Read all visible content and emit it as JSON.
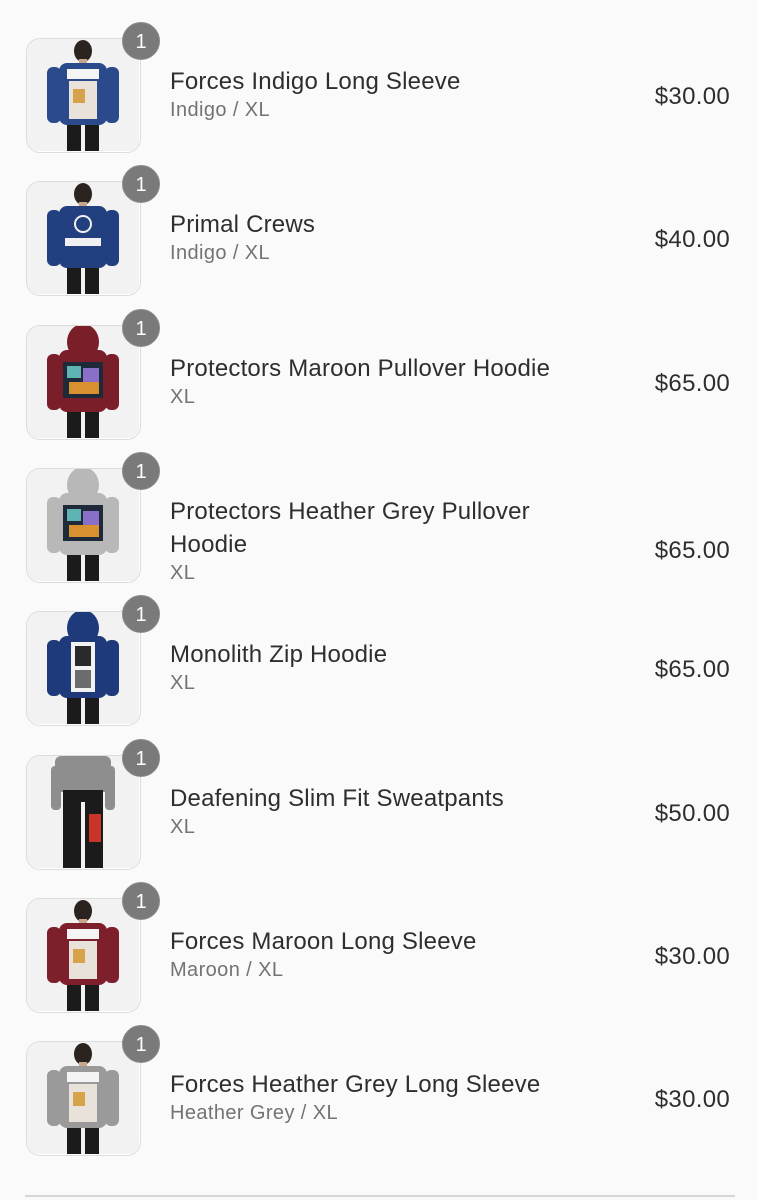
{
  "cart": {
    "items": [
      {
        "title": "Forces Indigo Long Sleeve",
        "variant": "Indigo / XL",
        "price": "$30.00",
        "quantity": "1",
        "shirt_color": "#2a4a8c",
        "art": "print-strip",
        "two_line": false
      },
      {
        "title": "Primal Crews",
        "variant": "Indigo / XL",
        "price": "$40.00",
        "quantity": "1",
        "shirt_color": "#22407f",
        "art": "logo-band",
        "two_line": false
      },
      {
        "title": "Protectors Maroon Pullover Hoodie",
        "variant": "XL",
        "price": "$65.00",
        "quantity": "1",
        "shirt_color": "#7a1e2a",
        "art": "panel",
        "two_line": false
      },
      {
        "title": "Protectors Heather Grey Pullover Hoodie",
        "variant": "XL",
        "price": "$65.00",
        "quantity": "1",
        "shirt_color": "#b8b8b8",
        "art": "panel",
        "two_line": true
      },
      {
        "title": "Monolith Zip Hoodie",
        "variant": "XL",
        "price": "$65.00",
        "quantity": "1",
        "shirt_color": "#1f3a7a",
        "art": "tall-print",
        "two_line": false
      },
      {
        "title": "Deafening Slim Fit Sweatpants",
        "variant": "XL",
        "price": "$50.00",
        "quantity": "1",
        "shirt_color": "#1b1b1b",
        "art": "pants",
        "two_line": false
      },
      {
        "title": "Forces Maroon Long Sleeve",
        "variant": "Maroon / XL",
        "price": "$30.00",
        "quantity": "1",
        "shirt_color": "#7e1f2c",
        "art": "print-strip",
        "two_line": false
      },
      {
        "title": "Forces Heather Grey Long Sleeve",
        "variant": "Heather Grey / XL",
        "price": "$30.00",
        "quantity": "1",
        "shirt_color": "#9a9a9a",
        "art": "print-strip",
        "two_line": false
      }
    ]
  }
}
